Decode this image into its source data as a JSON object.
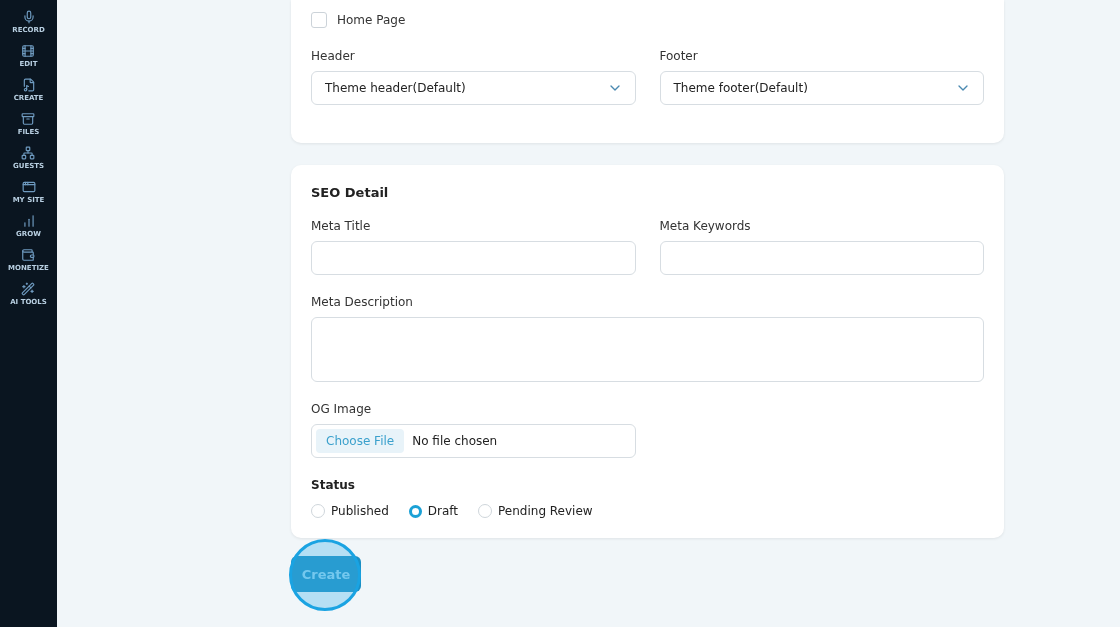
{
  "sidebar": {
    "items": [
      {
        "label": "RECORD"
      },
      {
        "label": "EDIT"
      },
      {
        "label": "CREATE"
      },
      {
        "label": "FILES"
      },
      {
        "label": "GUESTS"
      },
      {
        "label": "MY SITE"
      },
      {
        "label": "GROW"
      },
      {
        "label": "MONETIZE"
      },
      {
        "label": "AI TOOLS"
      }
    ]
  },
  "layout_card": {
    "home_page": {
      "label": "Home Page",
      "checked": false
    },
    "selects": [
      {
        "label": "Header",
        "value": "Theme header(Default)"
      },
      {
        "label": "Footer",
        "value": "Theme footer(Default)"
      }
    ]
  },
  "seo_card": {
    "title": "SEO Detail",
    "fields": [
      {
        "label": "Meta Title"
      },
      {
        "label": "Meta Keywords"
      }
    ],
    "description": {
      "label": "Meta Description"
    },
    "og_image": {
      "label": "OG Image",
      "button": "Choose File",
      "file": "No file chosen"
    },
    "status": {
      "label": "Status",
      "options": [
        {
          "label": "Published",
          "selected": false
        },
        {
          "label": "Draft",
          "selected": true
        },
        {
          "label": "Pending Review",
          "selected": false
        }
      ]
    }
  },
  "submit": {
    "label": "Create",
    "highlighted": true
  }
}
